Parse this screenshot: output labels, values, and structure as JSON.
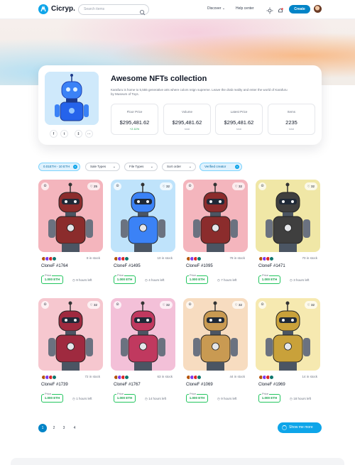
{
  "header": {
    "logo_text": "Cicryp.",
    "search_placeholder": "Search items",
    "nav_discover": "Discover",
    "nav_help": "Help center",
    "create_label": "Create",
    "accent": "#0284c7"
  },
  "collection": {
    "title": "Awesome NFTs collection",
    "description": "Karafuru is home to 5,555 generative arts where colors reign supreme. Leave the drab reality and enter the world of Karafuru by Museum of Toys.",
    "stats": [
      {
        "label": "Floor Price",
        "value": "$295,481.62",
        "sub": "+2.11%"
      },
      {
        "label": "Volume",
        "value": "$295,481.62",
        "sub": "total"
      },
      {
        "label": "Latest Price",
        "value": "$295,481.62",
        "sub": "total"
      },
      {
        "label": "Items",
        "value": "2235",
        "sub": "total"
      }
    ],
    "social_icons": [
      "facebook-icon",
      "twitter-icon",
      "share-icon",
      "more-icon"
    ]
  },
  "filters": [
    {
      "label": "0.01ETH - 10 ETH",
      "active": true
    },
    {
      "label": "Sale Types",
      "active": false
    },
    {
      "label": "File Types",
      "active": false
    },
    {
      "label": "Sort order",
      "active": false
    },
    {
      "label": "Verified creator",
      "active": true
    }
  ],
  "nfts": [
    {
      "name": "CloneF #1764",
      "likes": "25",
      "stock": "8 in stock",
      "price_label": "Price",
      "price": "1.000 ETH",
      "time_left": "9 hours left",
      "bg": "#f4b5bd",
      "body": "#8b2c2c"
    },
    {
      "name": "CloneF #1495",
      "likes": "32",
      "stock": "10 in stock",
      "price_label": "Price",
      "price": "1.000 ETH",
      "time_left": "4 hours left",
      "bg": "#bfe3fb",
      "body": "#3b82f6"
    },
    {
      "name": "CloneF #1095",
      "likes": "32",
      "stock": "78 in stock",
      "price_label": "Price",
      "price": "1.000 ETH",
      "time_left": "7 hours left",
      "bg": "#f4b5bd",
      "body": "#8b2c2c"
    },
    {
      "name": "CloneF #1471",
      "likes": "32",
      "stock": "70 in stock",
      "price_label": "Price",
      "price": "1.000 ETH",
      "time_left": "3 hours left",
      "bg": "#f0e7a6",
      "body": "#3f3f3f"
    },
    {
      "name": "CloneF #1739",
      "likes": "32",
      "stock": "72 in stock",
      "price_label": "Price",
      "price": "1.000 ETH",
      "time_left": "1 hours left",
      "bg": "#f6c7cf",
      "body": "#9f2a3f"
    },
    {
      "name": "CloneF #1767",
      "likes": "32",
      "stock": "63 in stock",
      "price_label": "Price",
      "price": "1.000 ETH",
      "time_left": "14 hours left",
      "bg": "#f3c0d8",
      "body": "#c0395f"
    },
    {
      "name": "CloneF #1069",
      "likes": "32",
      "stock": "44 in stock",
      "price_label": "Price",
      "price": "1.000 ETH",
      "time_left": "9 hours left",
      "bg": "#f7dcc0",
      "body": "#c99a52"
    },
    {
      "name": "CloneF #1969",
      "likes": "32",
      "stock": "14 in stock",
      "price_label": "Price",
      "price": "1.000 ETH",
      "time_left": "18 hours left",
      "bg": "#f6e9b0",
      "body": "#c9a13a"
    }
  ],
  "pagination": {
    "pages": [
      "1",
      "2",
      "3",
      "4"
    ],
    "active": "1"
  },
  "show_more_label": "Show me more"
}
